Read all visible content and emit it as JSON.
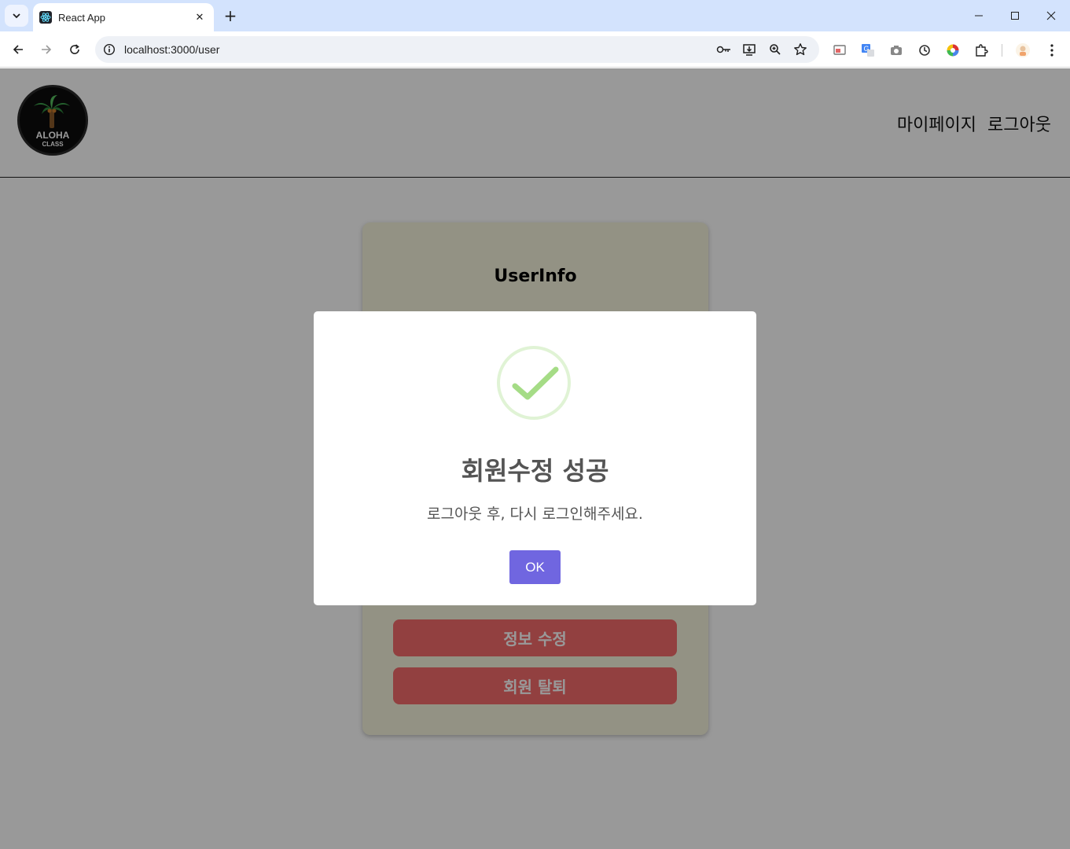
{
  "browser": {
    "tab_title": "React App",
    "url": "localhost:3000/user"
  },
  "header": {
    "logo_line1": "ALOHA",
    "logo_line2": "CLASS",
    "nav": [
      "마이페이지",
      "로그아웃"
    ]
  },
  "card": {
    "title": "UserInfo",
    "buttons": [
      "정보 수정",
      "회원 탈퇴"
    ]
  },
  "modal": {
    "icon": "success-check-icon",
    "title": "회원수정 성공",
    "text": "로그아웃 후, 다시 로그인해주세요.",
    "ok_label": "OK"
  },
  "colors": {
    "overlay": "rgba(0,0,0,0.4)",
    "card_bg": "#f5f3dd",
    "danger_button": "#f46b6b",
    "ok_button": "#7066e0",
    "success_green": "#a5dc86"
  }
}
